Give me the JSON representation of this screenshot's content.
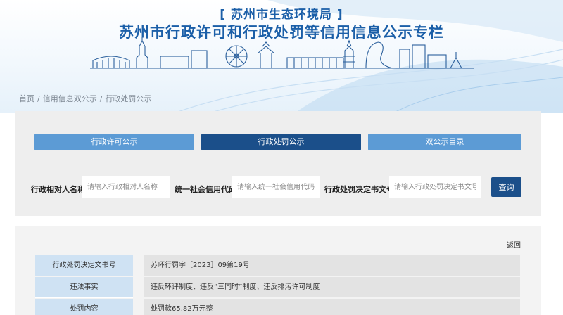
{
  "header": {
    "bureau": "[ 苏州市生态环境局 ]",
    "headline": "苏州市行政许可和行政处罚等信用信息公示专栏",
    "skyline_icon": "suzhou-skyline-illustration",
    "accent": "#1b5fa8"
  },
  "breadcrumb": [
    "首页",
    "信用信息双公示",
    "行政处罚公示"
  ],
  "tabs": [
    {
      "label": "行政许可公示",
      "active": false
    },
    {
      "label": "行政处罚公示",
      "active": true
    },
    {
      "label": "双公示目录",
      "active": false
    }
  ],
  "search": {
    "fields": [
      {
        "label": "行政相对人名称",
        "placeholder": "请输入行政相对人名称"
      },
      {
        "label": "统一社会信用代码",
        "placeholder": "请输入统一社会信用代码"
      },
      {
        "label": "行政处罚决定书文号",
        "placeholder": "请输入行政处罚决定书文号"
      }
    ],
    "button": "查询"
  },
  "detail": {
    "back": "返回",
    "rows": [
      {
        "label": "行政处罚决定文书号",
        "value": "苏环行罚字［2023］09第19号"
      },
      {
        "label": "违法事实",
        "value": "违反环评制度、违反“三同时”制度、违反排污许可制度"
      },
      {
        "label": "处罚内容",
        "value": "处罚款65.82万元整"
      }
    ]
  },
  "colors": {
    "tab_active": "#1b4f8a",
    "tab_inactive": "#5c9bd5",
    "label_cell": "#cfe2f3",
    "value_cell": "#e3e3e3"
  }
}
